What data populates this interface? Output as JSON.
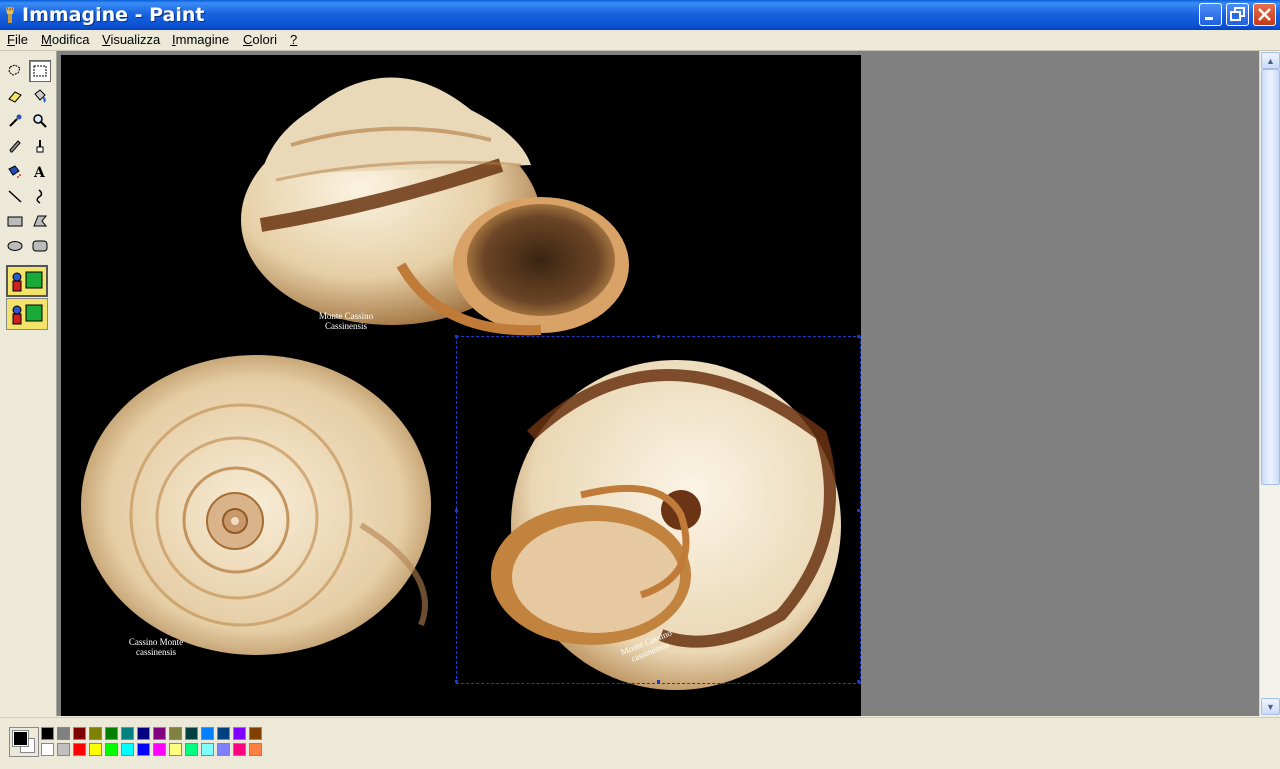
{
  "window": {
    "title": "Immagine - Paint"
  },
  "menu": [
    {
      "u": "F",
      "rest": "ile"
    },
    {
      "u": "M",
      "rest": "odifica"
    },
    {
      "u": "V",
      "rest": "isualizza"
    },
    {
      "u": "I",
      "rest": "mmagine"
    },
    {
      "u": "C",
      "rest": "olori"
    },
    {
      "u": "?",
      "rest": ""
    }
  ],
  "tools": [
    "free-select",
    "rect-select",
    "eraser",
    "fill",
    "color-picker",
    "magnifier",
    "pencil",
    "brush",
    "airbrush",
    "text",
    "line",
    "curve",
    "rectangle",
    "polygon",
    "ellipse",
    "rounded-rectangle"
  ],
  "captions": {
    "top": [
      "Monte Cassino",
      "Cassinensis"
    ],
    "left": [
      "Cassino Monte",
      "cassinensis"
    ],
    "right": [
      "Monte Cassino",
      "cassinensis"
    ]
  },
  "colors": {
    "current_fg": "#000000",
    "current_bg": "#ffffff",
    "palette_row1": [
      "#000000",
      "#808080",
      "#800000",
      "#808000",
      "#008000",
      "#008080",
      "#000080",
      "#800080",
      "#808040",
      "#004040",
      "#0080ff",
      "#004080",
      "#8000ff",
      "#804000"
    ],
    "palette_row2": [
      "#ffffff",
      "#c0c0c0",
      "#ff0000",
      "#ffff00",
      "#00ff00",
      "#00ffff",
      "#0000ff",
      "#ff00ff",
      "#ffff80",
      "#00ff80",
      "#80ffff",
      "#8080ff",
      "#ff0080",
      "#ff8040"
    ]
  }
}
